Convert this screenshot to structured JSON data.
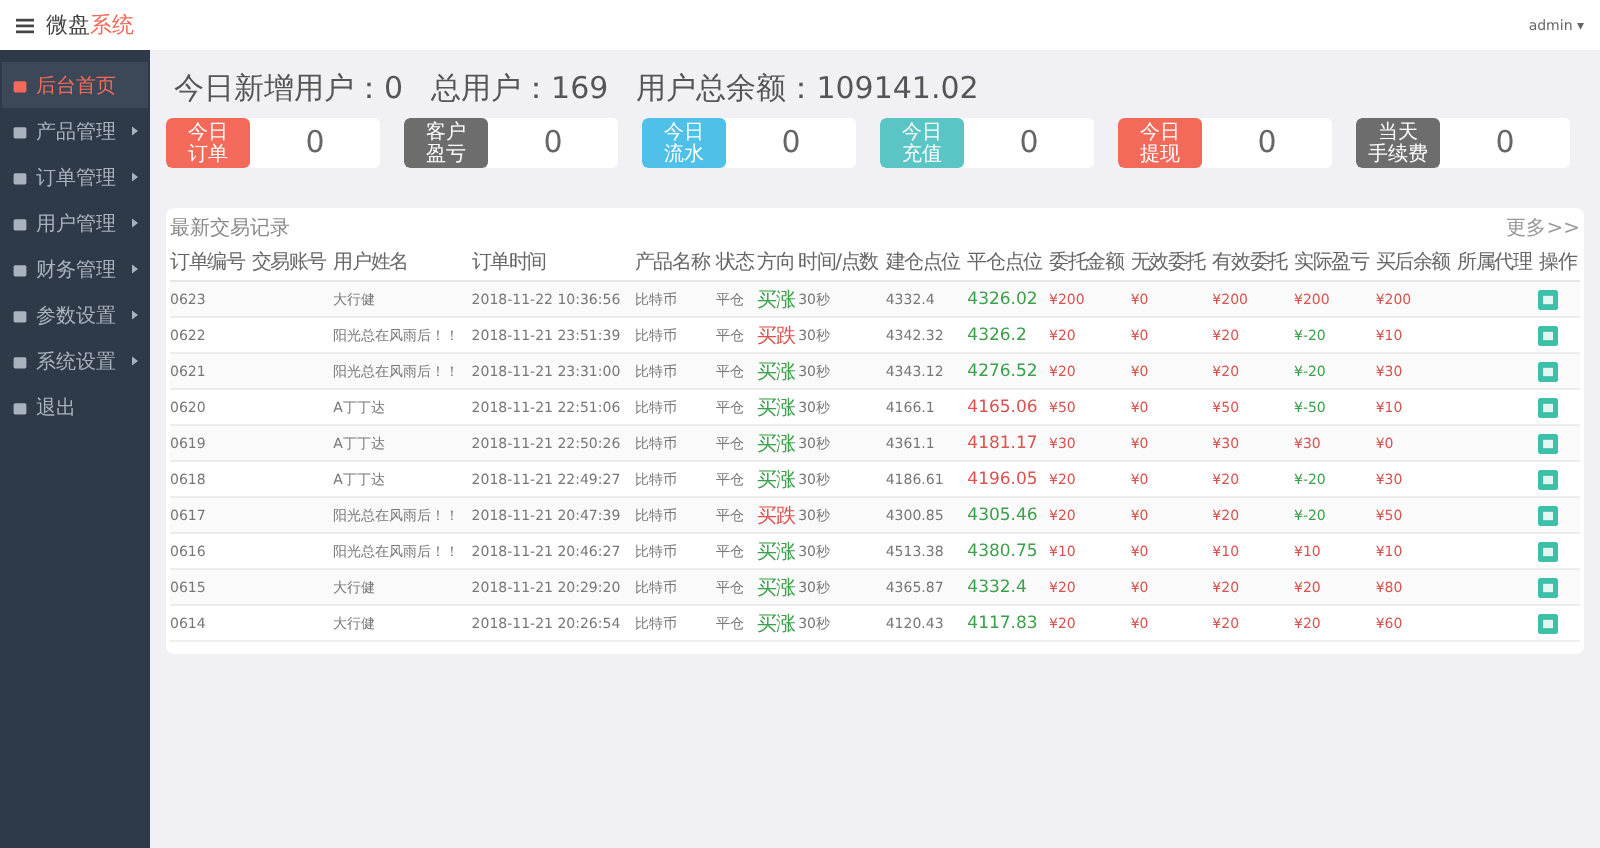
{
  "header": {
    "brand_main": "微盘",
    "brand_accent": "系统",
    "user": "admin",
    "user_caret": "▾"
  },
  "sidebar": {
    "items": [
      {
        "label": "后台首页",
        "selected": true,
        "has_submenu": false
      },
      {
        "label": "产品管理",
        "selected": false,
        "has_submenu": true
      },
      {
        "label": "订单管理",
        "selected": false,
        "has_submenu": true
      },
      {
        "label": "用户管理",
        "selected": false,
        "has_submenu": true
      },
      {
        "label": "财务管理",
        "selected": false,
        "has_submenu": true
      },
      {
        "label": "参数设置",
        "selected": false,
        "has_submenu": true
      },
      {
        "label": "系统设置",
        "selected": false,
        "has_submenu": true
      },
      {
        "label": "退出",
        "selected": false,
        "has_submenu": false
      }
    ]
  },
  "summary": [
    {
      "label": "今日新增用户：",
      "value": "0"
    },
    {
      "label": "总用户：",
      "value": "169"
    },
    {
      "label": "用户总余额：",
      "value": "109141.02"
    }
  ],
  "stat_cards": [
    {
      "label_lines": [
        "今日",
        "订单"
      ],
      "value": "0",
      "color": "#f36a5a"
    },
    {
      "label_lines": [
        "客户",
        "盈亏"
      ],
      "value": "0",
      "color": "#6d6d6d"
    },
    {
      "label_lines": [
        "今日",
        "流水"
      ],
      "value": "0",
      "color": "#4fc1e9"
    },
    {
      "label_lines": [
        "今日",
        "充值"
      ],
      "value": "0",
      "color": "#5bc4c4"
    },
    {
      "label_lines": [
        "今日",
        "提现"
      ],
      "value": "0",
      "color": "#f36a5a"
    },
    {
      "label_lines": [
        "当天",
        "手续费"
      ],
      "value": "0",
      "color": "#6d6d6d"
    }
  ],
  "table": {
    "title": "最新交易记录",
    "more_link": "更多>>",
    "columns": [
      "订单编号",
      "交易账号",
      "用户姓名",
      "订单时间",
      "产品名称",
      "状态",
      "方向",
      "时间/点数",
      "建仓点位",
      "平仓点位",
      "委托金额",
      "无效委托",
      "有效委托",
      "实际盈亏",
      "买后余额",
      "所属代理",
      "操作"
    ],
    "rows": [
      {
        "id": "0623",
        "name": "大行健",
        "time": "2018-11-22 10:36:56",
        "product": "比特币",
        "status": "平仓",
        "direction": "买涨",
        "dir_up": true,
        "period": "30秒",
        "open": "4332.4",
        "close": "4326.02",
        "close_up": true,
        "amount": "¥200",
        "invalid": "¥0",
        "valid": "¥200",
        "pnl": "¥200",
        "pnl_loss": false,
        "balance": "¥200"
      },
      {
        "id": "0622",
        "name": "阳光总在风雨后！！",
        "time": "2018-11-21 23:51:39",
        "product": "比特币",
        "status": "平仓",
        "direction": "买跌",
        "dir_up": false,
        "period": "30秒",
        "open": "4342.32",
        "close": "4326.2",
        "close_up": true,
        "amount": "¥20",
        "invalid": "¥0",
        "valid": "¥20",
        "pnl": "¥-20",
        "pnl_loss": true,
        "balance": "¥10"
      },
      {
        "id": "0621",
        "name": "阳光总在风雨后！！",
        "time": "2018-11-21 23:31:00",
        "product": "比特币",
        "status": "平仓",
        "direction": "买涨",
        "dir_up": true,
        "period": "30秒",
        "open": "4343.12",
        "close": "4276.52",
        "close_up": true,
        "amount": "¥20",
        "invalid": "¥0",
        "valid": "¥20",
        "pnl": "¥-20",
        "pnl_loss": true,
        "balance": "¥30"
      },
      {
        "id": "0620",
        "name": "A丁丁达",
        "time": "2018-11-21 22:51:06",
        "product": "比特币",
        "status": "平仓",
        "direction": "买涨",
        "dir_up": true,
        "period": "30秒",
        "open": "4166.1",
        "close": "4165.06",
        "close_up": false,
        "amount": "¥50",
        "invalid": "¥0",
        "valid": "¥50",
        "pnl": "¥-50",
        "pnl_loss": true,
        "balance": "¥10"
      },
      {
        "id": "0619",
        "name": "A丁丁达",
        "time": "2018-11-21 22:50:26",
        "product": "比特币",
        "status": "平仓",
        "direction": "买涨",
        "dir_up": true,
        "period": "30秒",
        "open": "4361.1",
        "close": "4181.17",
        "close_up": false,
        "amount": "¥30",
        "invalid": "¥0",
        "valid": "¥30",
        "pnl": "¥30",
        "pnl_loss": false,
        "balance": "¥0"
      },
      {
        "id": "0618",
        "name": "A丁丁达",
        "time": "2018-11-21 22:49:27",
        "product": "比特币",
        "status": "平仓",
        "direction": "买涨",
        "dir_up": true,
        "period": "30秒",
        "open": "4186.61",
        "close": "4196.05",
        "close_up": false,
        "amount": "¥20",
        "invalid": "¥0",
        "valid": "¥20",
        "pnl": "¥-20",
        "pnl_loss": true,
        "balance": "¥30"
      },
      {
        "id": "0617",
        "name": "阳光总在风雨后！！",
        "time": "2018-11-21 20:47:39",
        "product": "比特币",
        "status": "平仓",
        "direction": "买跌",
        "dir_up": false,
        "period": "30秒",
        "open": "4300.85",
        "close": "4305.46",
        "close_up": true,
        "amount": "¥20",
        "invalid": "¥0",
        "valid": "¥20",
        "pnl": "¥-20",
        "pnl_loss": true,
        "balance": "¥50"
      },
      {
        "id": "0616",
        "name": "阳光总在风雨后！！",
        "time": "2018-11-21 20:46:27",
        "product": "比特币",
        "status": "平仓",
        "direction": "买涨",
        "dir_up": true,
        "period": "30秒",
        "open": "4513.38",
        "close": "4380.75",
        "close_up": true,
        "amount": "¥10",
        "invalid": "¥0",
        "valid": "¥10",
        "pnl": "¥10",
        "pnl_loss": false,
        "balance": "¥10"
      },
      {
        "id": "0615",
        "name": "大行健",
        "time": "2018-11-21 20:29:20",
        "product": "比特币",
        "status": "平仓",
        "direction": "买涨",
        "dir_up": true,
        "period": "30秒",
        "open": "4365.87",
        "close": "4332.4",
        "close_up": true,
        "amount": "¥20",
        "invalid": "¥0",
        "valid": "¥20",
        "pnl": "¥20",
        "pnl_loss": false,
        "balance": "¥80"
      },
      {
        "id": "0614",
        "name": "大行健",
        "time": "2018-11-21 20:26:54",
        "product": "比特币",
        "status": "平仓",
        "direction": "买涨",
        "dir_up": true,
        "period": "30秒",
        "open": "4120.43",
        "close": "4117.83",
        "close_up": true,
        "amount": "¥20",
        "invalid": "¥0",
        "valid": "¥20",
        "pnl": "¥20",
        "pnl_loss": false,
        "balance": "¥60"
      }
    ]
  }
}
